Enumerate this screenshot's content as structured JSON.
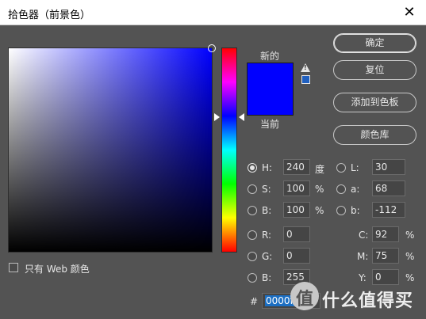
{
  "window": {
    "title": "拾色器（前景色）",
    "close_symbol": "✕"
  },
  "swatches": {
    "new_label": "新的",
    "current_label": "当前",
    "new_color": "#0000ff",
    "current_color": "#0000ff"
  },
  "buttons": {
    "ok": "确定",
    "reset": "复位",
    "add_to_swatches": "添加到色板",
    "color_libraries": "颜色库"
  },
  "hsb": {
    "h": {
      "label": "H:",
      "value": "240",
      "unit": "度",
      "selected": true
    },
    "s": {
      "label": "S:",
      "value": "100",
      "unit": "%"
    },
    "b": {
      "label": "B:",
      "value": "100",
      "unit": "%"
    }
  },
  "rgb": {
    "r": {
      "label": "R:",
      "value": "0"
    },
    "g": {
      "label": "G:",
      "value": "0"
    },
    "b": {
      "label": "B:",
      "value": "255"
    }
  },
  "lab": {
    "l": {
      "label": "L:",
      "value": "30"
    },
    "a": {
      "label": "a:",
      "value": "68"
    },
    "b": {
      "label": "b:",
      "value": "-112"
    }
  },
  "cmyk": {
    "c": {
      "label": "C:",
      "value": "92",
      "unit": "%"
    },
    "m": {
      "label": "M:",
      "value": "75",
      "unit": "%"
    },
    "y": {
      "label": "Y:",
      "value": "0",
      "unit": "%"
    }
  },
  "hex": {
    "label": "#",
    "value": "0000ff"
  },
  "web_only": {
    "label": "只有 Web 颜色",
    "checked": false
  },
  "watermark": {
    "glyph": "值",
    "text": "什么值得买"
  }
}
